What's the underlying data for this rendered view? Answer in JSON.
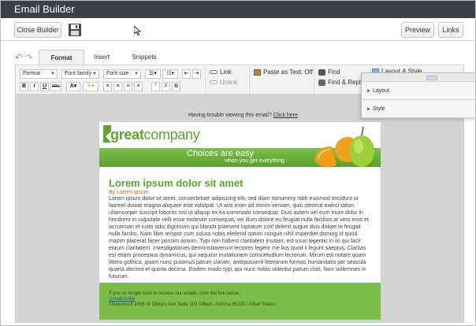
{
  "app": {
    "title": "Email Builder"
  },
  "topbar": {
    "close_label": "Close Builder",
    "preview_label": "Preview",
    "links_label": "Links"
  },
  "tabs": [
    {
      "label": "Format",
      "active": true
    },
    {
      "label": "Insert",
      "active": false
    },
    {
      "label": "Snippets",
      "active": false
    }
  ],
  "toolbar": {
    "format_select": "Format",
    "font_family_select": "Font family",
    "font_size_select": "Font size",
    "bold": "B",
    "italic": "I",
    "underline": "U",
    "strike": "ABC",
    "link": "Link",
    "unlink": "Unlink",
    "paste_text": "Paste as Text: Off",
    "find": "Find",
    "find_replace": "Find & Replace",
    "layout_style": "Layout & Style"
  },
  "panel": {
    "layout": "Layout",
    "style": "Style"
  },
  "email": {
    "trouble_text": "Having trouble viewing this email?",
    "trouble_link": "Click here",
    "logo_bold": "great",
    "logo_thin": "company",
    "banner_main": "Choices are easy",
    "banner_sub": "when you get everything",
    "heading": "Lorem ipsum dolor sit amet",
    "byline": "By Lorem ipsum",
    "body": "Lorem ipsum dolor sit amet, consectetuer adipiscing elit, sed diam nonummy nibh euismod tincidunt ut laoreet dolore magna aliquam erat volutpat. Ut wisi enim ad minim veniam, quis nostrud exerci tation ullamcorper suscipit lobortis nisl ut aliquip ex ea commodo consequat. Duis autem vel eum iriure dolor in hendrerit in vulputate velit esse molestie consequat, vel illum dolore eu feugiat nulla facilisis at vero eros et accumsan et iusto odio dignissim qui blandit praesent luptatum zzril delenit augue duis dolore te feugait nulla facilisi. Nam liber tempor cum soluta nobis eleifend option congue nihil imperdiet doming id quod mazim placerat facer possim assum. Typi non habent claritatem insitam; est usus legentis in iis qui facit eorum claritatem. Investigationes demonstraverunt lectores legere me lius quod ii legunt saepius. Claritas est etiam processus dynamicus, qui sequitur mutationem consuetudium lectorum. Mirum est notare quam littera gothica, quam nunc putamus parum claram, anteposuerit litterarum formas humanitatis per seacula quarta decima et quinta decima. Eodem modo typi, qui nunc nobis videntur parum clari, fiant sollemnes in futurum.",
    "footer_line1": "If you no longer wish to receive our emails, click the link below:",
    "footer_unsubscribe": "Unsubscribe",
    "footer_address": "Infusionsoft 2065 W Obispo Ave Suite 103 Gilbert, Arizona 85233 United States"
  }
}
